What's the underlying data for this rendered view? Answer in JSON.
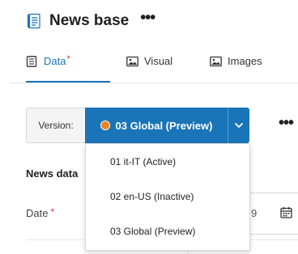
{
  "header": {
    "title": "News base",
    "icon": "document-icon",
    "more_icon": "more-horizontal-icon"
  },
  "tabs": [
    {
      "label": "Data",
      "required_marker": "*",
      "icon": "document-icon",
      "active": true
    },
    {
      "label": "Visual",
      "icon": "image-icon",
      "active": false
    },
    {
      "label": "Images",
      "icon": "image-icon",
      "active": false
    }
  ],
  "version": {
    "label": "Version:",
    "selected": "03 Global (Preview)",
    "status_color": "#f0821e",
    "options": [
      "01 it-IT (Active)",
      "02 en-US (Inactive)",
      "03 Global (Preview)"
    ]
  },
  "section": {
    "title": "News data"
  },
  "fields": {
    "date_label": "Date",
    "date_required_marker": "*",
    "date_value_fragment": "9"
  },
  "colors": {
    "accent": "#1a74b8",
    "required": "#d9312b"
  }
}
